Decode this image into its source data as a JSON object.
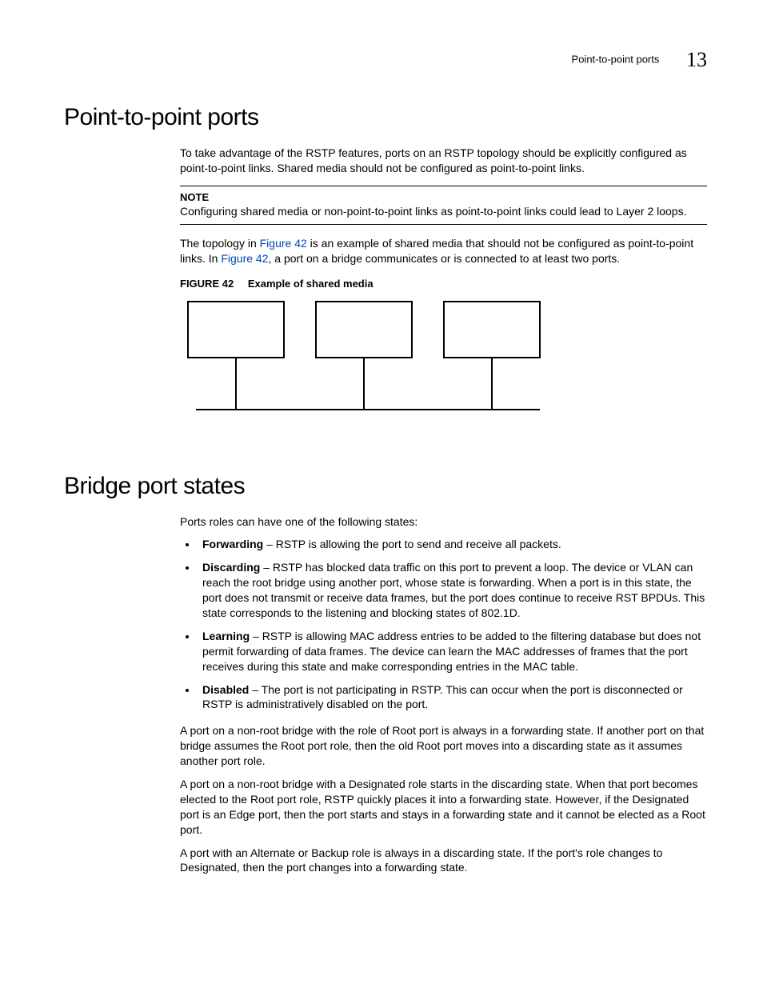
{
  "header": {
    "running_title": "Point-to-point ports",
    "chapter_number": "13"
  },
  "section1": {
    "heading": "Point-to-point ports",
    "intro": "To take advantage of the RSTP features, ports on an RSTP topology should be explicitly configured as point-to-point links. Shared media should not be configured as point-to-point links.",
    "note_label": "NOTE",
    "note_body": "Configuring shared media or non-point-to-point links as point-to-point links could lead to Layer 2 loops.",
    "topology_pre": "The topology in ",
    "fig_ref1": "Figure 42",
    "topology_mid": " is an example of shared media that should not be configured as point-to-point links. In ",
    "fig_ref2": "Figure 42",
    "topology_post": ", a port on a bridge communicates or is connected to at least two ports.",
    "figure_label": "FIGURE 42",
    "figure_title": "Example of shared media"
  },
  "section2": {
    "heading": "Bridge port states",
    "intro": "Ports roles can have one of the following states:",
    "states": [
      {
        "name": "Forwarding",
        "desc": " – RSTP is allowing the port to send and receive all packets."
      },
      {
        "name": "Discarding",
        "desc": " – RSTP has blocked data traffic on this port to prevent a loop.  The device or VLAN can reach the root bridge using another port, whose state is forwarding.  When a port is in this state, the port does not transmit or receive data frames, but the port does continue to receive RST BPDUs.  This state corresponds to the listening and blocking states of 802.1D."
      },
      {
        "name": "Learning",
        "desc": " – RSTP is allowing MAC address entries to be added to the filtering database but does not permit forwarding of data frames. The device can learn the MAC addresses of frames that the port receives during this state and make corresponding entries in the MAC table."
      },
      {
        "name": "Disabled",
        "desc": " – The port is not participating in RSTP.  This can occur when the port is disconnected or RSTP is administratively disabled on the port."
      }
    ],
    "para1": "A port on a non-root bridge with the role of Root port is always in a forwarding state. If another port on that bridge assumes the Root port role, then the old Root port moves into a discarding state as it assumes another port role.",
    "para2": "A port on a non-root bridge with a Designated role starts in the discarding state. When that port becomes elected to the Root port role, RSTP quickly places it into a forwarding state. However, if the Designated port is an Edge port, then the port starts and stays in a forwarding state and it cannot be elected as a Root port.",
    "para3": "A port with an Alternate or Backup role is always in a discarding state. If the port's role changes to Designated, then the port changes into a forwarding state."
  }
}
